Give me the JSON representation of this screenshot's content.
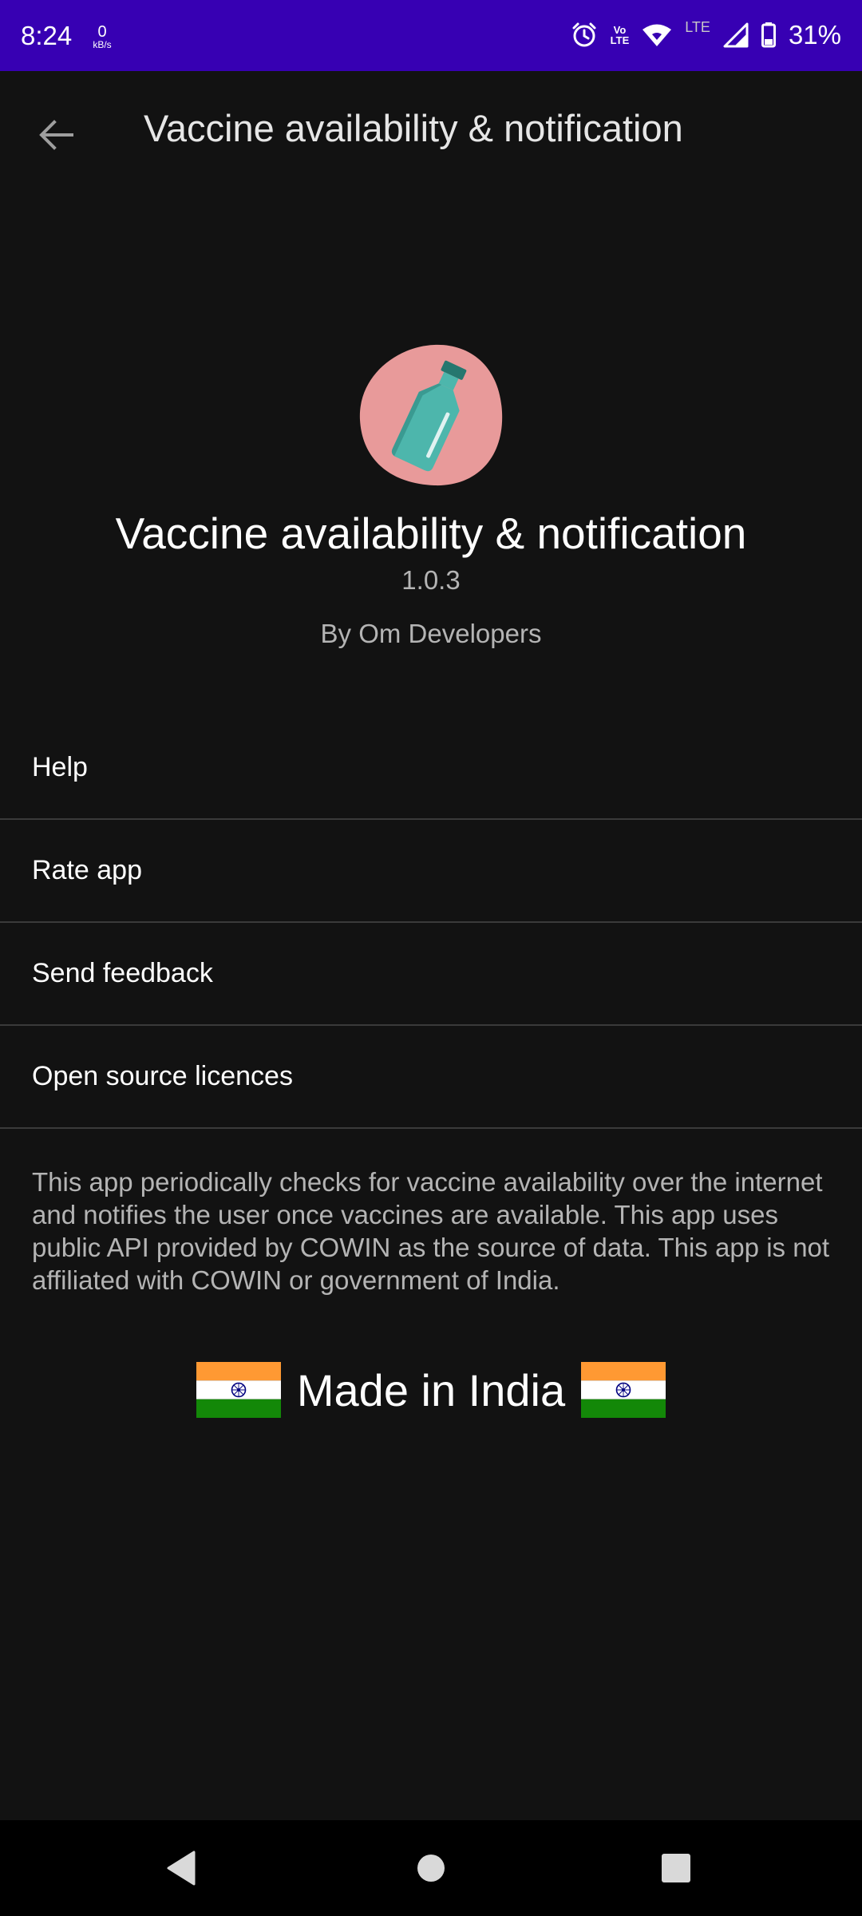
{
  "status_bar": {
    "time": "8:24",
    "net_speed_value": "0",
    "net_speed_unit": "kB/s",
    "volte_line1": "Vo",
    "volte_line2": "LTE",
    "lte_label": "LTE",
    "battery_percent": "31%",
    "icons": [
      "alarm-icon",
      "volte-icon",
      "wifi-icon",
      "signal-icon",
      "battery-icon"
    ]
  },
  "app_bar": {
    "title": "Vaccine availability & notification",
    "back_icon": "arrow-back-icon"
  },
  "about": {
    "app_name": "Vaccine availability & notification",
    "version": "1.0.3",
    "developer": "By Om Developers",
    "logo_icon": "vaccine-bottle-icon"
  },
  "menu": {
    "items": [
      {
        "label": "Help"
      },
      {
        "label": "Rate app"
      },
      {
        "label": "Send feedback"
      },
      {
        "label": "Open source licences"
      }
    ]
  },
  "disclaimer": "This app periodically checks for vaccine availability over the internet and notifies the user once vaccines are available. This app uses public API provided by COWIN as the source of data. This app is not affiliated with COWIN or government of India.",
  "made_in": {
    "text": "Made in India",
    "flag_icon": "india-flag-icon"
  },
  "nav_bar": {
    "icons": [
      "nav-back-icon",
      "nav-home-icon",
      "nav-recents-icon"
    ]
  },
  "colors": {
    "status_bar": "#3700b3",
    "background": "#121212",
    "logo_blob": "#e89a9a",
    "bottle": "#4db6ac",
    "flag_saffron": "#ff9933",
    "flag_green": "#138808",
    "flag_chakra": "#000080"
  }
}
